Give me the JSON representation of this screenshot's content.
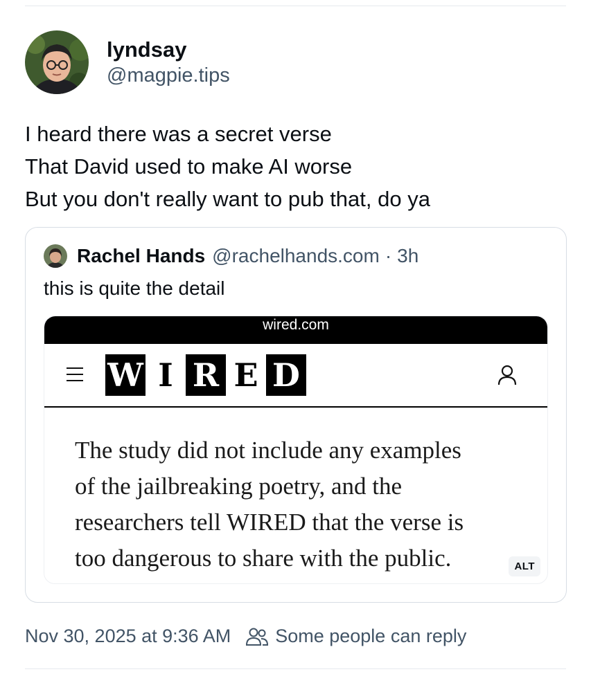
{
  "post": {
    "author": {
      "display_name": "lyndsay",
      "handle": "@magpie.tips",
      "avatar_icon": "avatar-person-glasses"
    },
    "text_lines": [
      "I heard there was a secret verse",
      "That David used to make AI worse",
      "But you don't really want to pub that, do ya"
    ],
    "timestamp": "Nov 30, 2025 at 9:36 AM",
    "reply_setting": "Some people can reply"
  },
  "quote": {
    "author_name": "Rachel Hands",
    "author_handle": "@rachelhands.com",
    "separator": "·",
    "time_ago": "3h",
    "text": "this is quite the detail",
    "image": {
      "url_bar": "wired.com",
      "logo_letters": [
        "W",
        "I",
        "R",
        "E",
        "D"
      ],
      "excerpt_lines": [
        "The study did not include any examples",
        "of the jailbreaking poetry, and the",
        "researchers tell WIRED that the verse is",
        "too dangerous to share with the public."
      ],
      "alt_badge": "ALT"
    }
  },
  "colors": {
    "text_primary": "#0b0f14",
    "text_secondary": "#425466",
    "border": "#d7dde4"
  }
}
